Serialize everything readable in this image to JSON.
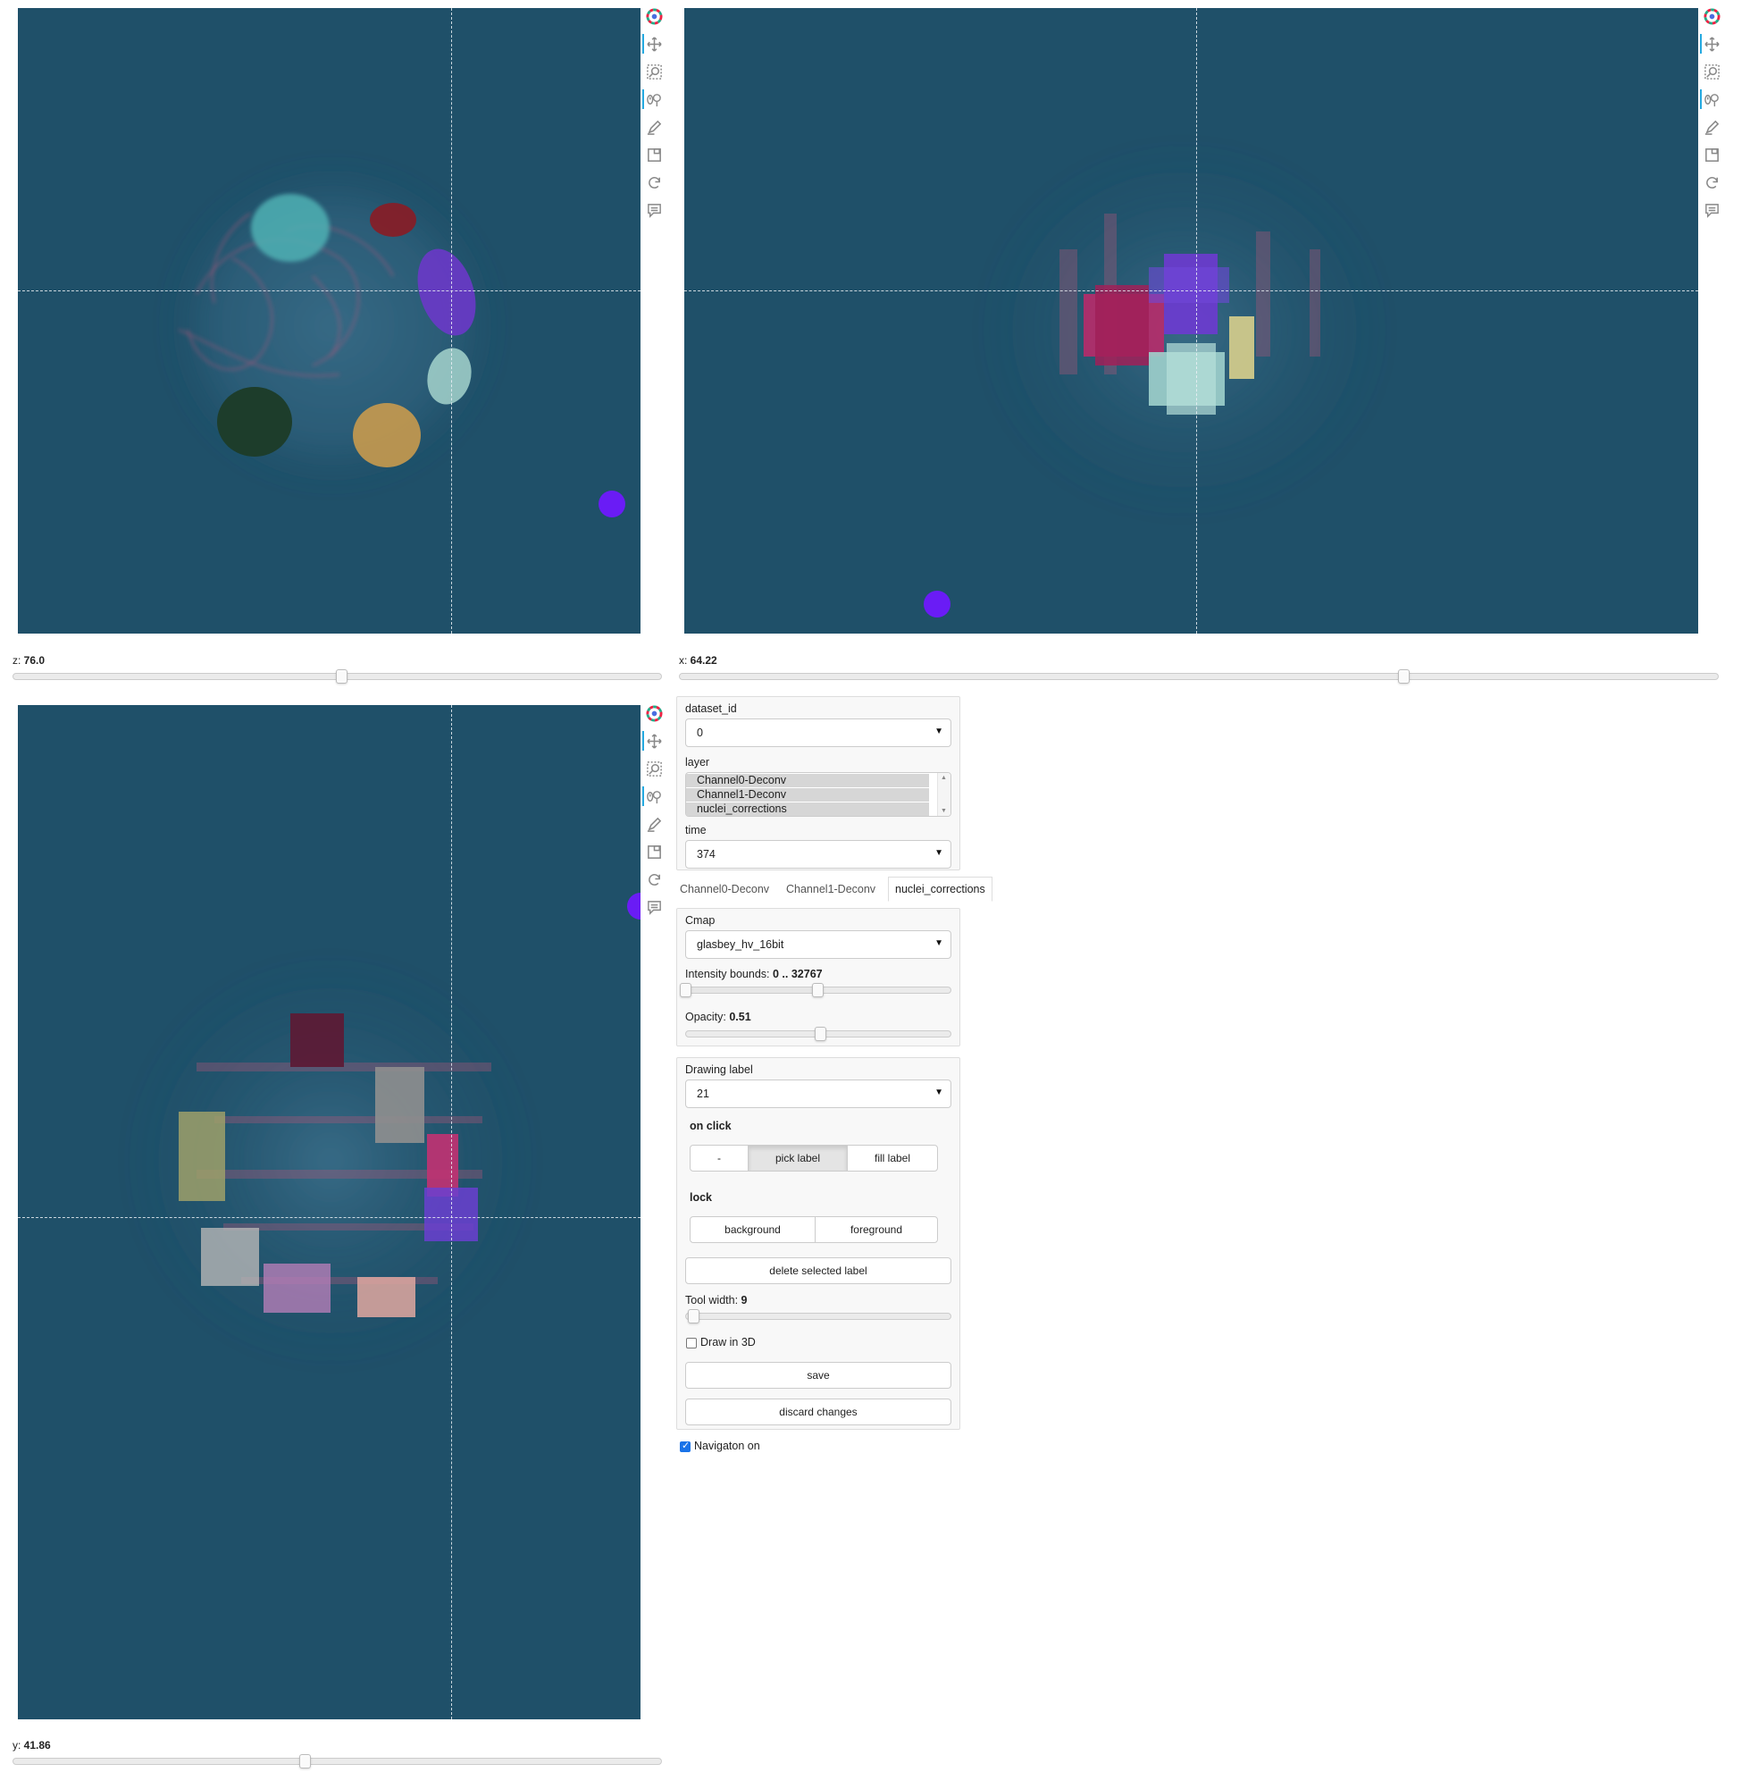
{
  "panels": {
    "z": {
      "slider_name": "z",
      "slider_value": "76.0",
      "slider_fraction": 0.508
    },
    "x": {
      "slider_name": "x",
      "slider_value": "64.22",
      "slider_fraction": 0.698
    },
    "y": {
      "slider_name": "y",
      "slider_value": "41.86",
      "slider_fraction": 0.451
    }
  },
  "toolbar_icons": [
    "bokeh-logo-icon",
    "pan-icon",
    "box-zoom-icon",
    "wheel-zoom-icon",
    "freehand-draw-icon",
    "save-icon",
    "reset-icon",
    "hover-icon"
  ],
  "controls": {
    "dataset_label": "dataset_id",
    "dataset_value": "0",
    "layer_label": "layer",
    "layer_options": [
      "Channel0-Deconv",
      "Channel1-Deconv",
      "nuclei_corrections"
    ],
    "time_label": "time",
    "time_value": "374"
  },
  "tabs": [
    {
      "label": "Channel0-Deconv",
      "active": false
    },
    {
      "label": "Channel1-Deconv",
      "active": false
    },
    {
      "label": "nuclei_corrections",
      "active": true
    }
  ],
  "display": {
    "cmap_label": "Cmap",
    "cmap_value": "glasbey_hv_16bit",
    "intensity_label": "Intensity bounds:",
    "intensity_value": "0 .. 32767",
    "intensity_fraction": [
      0.0,
      0.5
    ],
    "opacity_label": "Opacity:",
    "opacity_value": "0.51",
    "opacity_fraction": 0.51
  },
  "editing": {
    "drawing_label": "Drawing label",
    "drawing_value": "21",
    "on_click_label": "on click",
    "on_click_options": [
      "-",
      "pick label",
      "fill label"
    ],
    "on_click_selected": "pick label",
    "lock_label": "lock",
    "lock_options": [
      "background",
      "foreground"
    ],
    "delete_label": "delete selected label",
    "tool_width_label": "Tool width:",
    "tool_width_value": "9",
    "tool_width_fraction": 0.03,
    "draw3d_label": "Draw in 3D",
    "draw3d_checked": false,
    "save_label": "save",
    "discard_label": "discard changes"
  },
  "navigation": {
    "label": "Navigaton on",
    "checked": true
  },
  "colors": {
    "background": "#1f5069",
    "crosshair": "#ebf0f5",
    "cursor_dot": "#6a1cf5",
    "active_tool": "#26aae1"
  }
}
